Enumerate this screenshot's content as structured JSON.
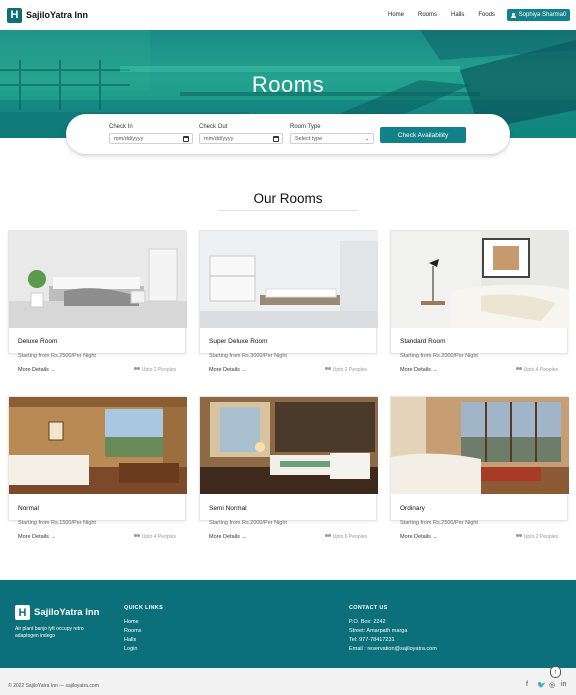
{
  "nav": {
    "brand_letter": "H",
    "brand": "SajiloYatra Inn",
    "links": [
      "Home",
      "Rooms",
      "Halls",
      "Foods"
    ],
    "user": "Sophiya Sharma0"
  },
  "hero": {
    "title": "Rooms"
  },
  "booking": {
    "check_in_label": "Check In",
    "check_in_placeholder": "mm/dd/yyyy",
    "check_out_label": "Check Out",
    "check_out_placeholder": "mm/dd/yyyy",
    "room_type_label": "Room Type",
    "room_type_value": "Select type",
    "button": "Check Availability"
  },
  "section_title": "Our Rooms",
  "rooms": [
    {
      "name": "Deluxe Room",
      "price": "Starting from Rs.2500/Per Night",
      "more": "More Details",
      "people": "Upto 2 Peoples"
    },
    {
      "name": "Super Deluxe Room",
      "price": "Starting from Rs.3000/Per Night",
      "more": "More Details",
      "people": "Upto 2 Peoples"
    },
    {
      "name": "Standard Room",
      "price": "Starting from Rs.2000/Per Night",
      "more": "More Details",
      "people": "Upto 4 Peoples"
    },
    {
      "name": "Normal",
      "price": "Starting from Rs.1500/Per Night",
      "more": "More Details",
      "people": "Upto 4 Peoples"
    },
    {
      "name": "Semi Normal",
      "price": "Starting from Rs.2000/Per Night",
      "more": "More Details",
      "people": "Upto 6 Peoples"
    },
    {
      "name": "Ordinary",
      "price": "Starting from Rs.2500/Per Night",
      "more": "More Details",
      "people": "Upto 2 Peoples"
    }
  ],
  "footer": {
    "brand_letter": "H",
    "brand": "SajiloYatra Inn",
    "tagline": "Air plant banjo lyft occupy retro adaptogen indego",
    "quick_links_title": "QUICK LINKS",
    "quick_links": [
      "Home",
      "Rooms",
      "Halls",
      "Login"
    ],
    "contact_title": "CONTACT US",
    "contact": [
      "P.O. Box: 2242",
      "Street: Amarpath marga",
      "Tel: 977-78417231",
      "Email : reservation@sajiloyatra.com"
    ],
    "copyright": "© 2022 SajiloYatra Inn — sajiloyatra.com"
  },
  "social": {
    "facebook": "f",
    "twitter": "🐦",
    "instagram": "◎",
    "linkedin": "in"
  },
  "colors": {
    "primary": "#13818a",
    "footer": "#0b707a"
  }
}
